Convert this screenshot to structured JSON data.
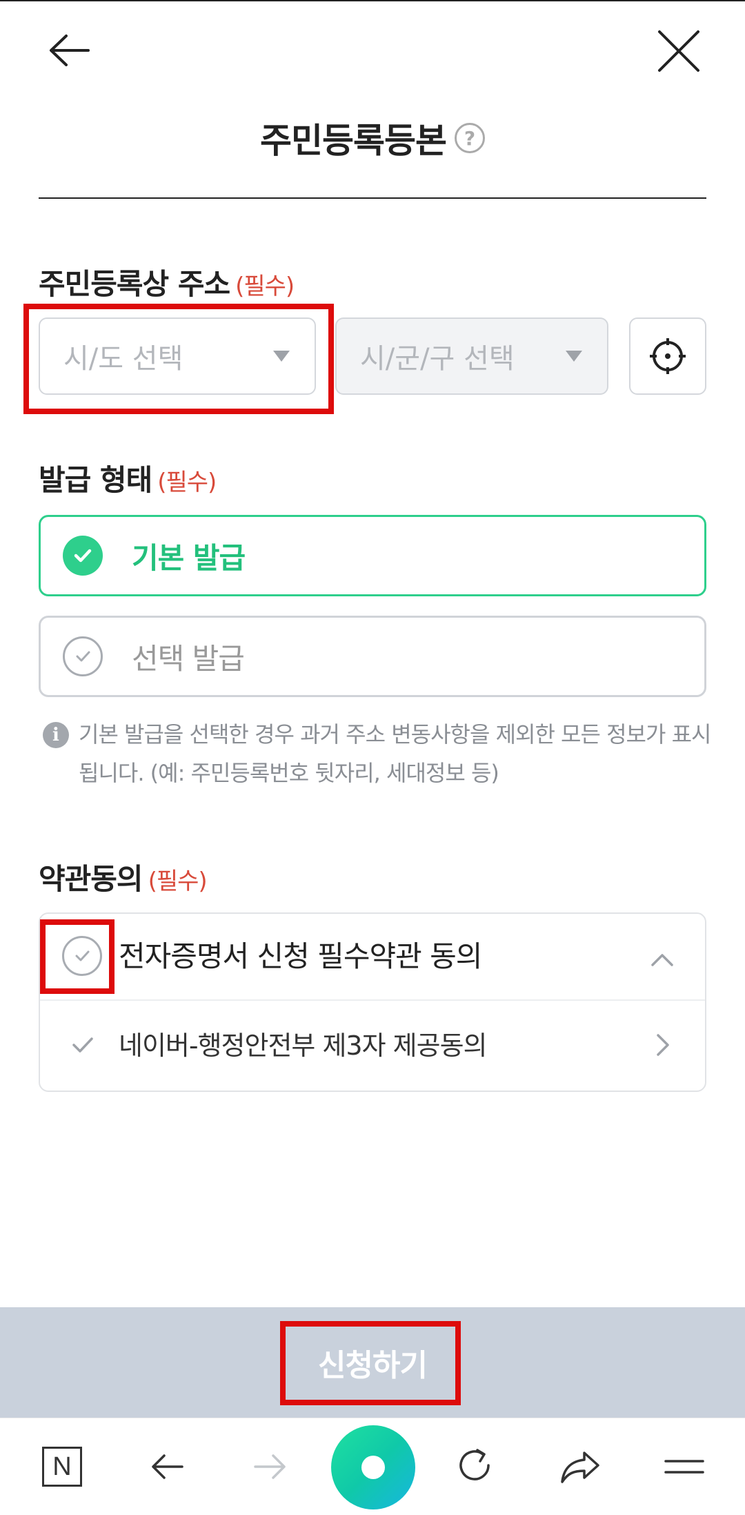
{
  "header": {
    "title": "주민등록등본",
    "help_icon": "?"
  },
  "address": {
    "label": "주민등록상 주소",
    "required": "(필수)",
    "sido_placeholder": "시/도 선택",
    "sigungu_placeholder": "시/군/구 선택"
  },
  "issue_type": {
    "label": "발급 형태",
    "required": "(필수)",
    "options": [
      {
        "label": "기본 발급",
        "selected": true
      },
      {
        "label": "선택 발급",
        "selected": false
      }
    ],
    "info_icon": "i",
    "info_text": "기본 발급을 선택한 경우 과거 주소 변동사항을 제외한 모든 정보가 표시됩니다. (예: 주민등록번호 뒷자리, 세대정보 등)"
  },
  "terms": {
    "label": "약관동의",
    "required": "(필수)",
    "main_label": "전자증명서 신청 필수약관 동의",
    "sub_label": "네이버-행정안전부 제3자 제공동의"
  },
  "submit": {
    "label": "신청하기"
  },
  "browser_bar": {
    "home_label": "N"
  },
  "colors": {
    "accent_green": "#2ecf8c",
    "required_red": "#d84a3a",
    "submit_disabled": "#c9d1dc",
    "highlight_red": "#dd0b0b"
  }
}
